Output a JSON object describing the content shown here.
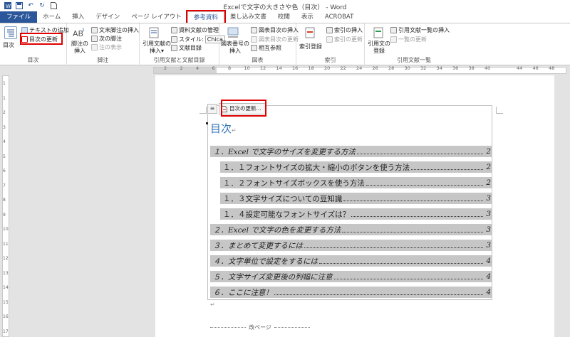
{
  "window": {
    "title": "Excelで文字の大きさや色（目次） - Word"
  },
  "qat": {
    "save_icon": "save-icon",
    "undo_icon": "undo-icon",
    "redo_icon": "redo-icon",
    "new_icon": "new-document-icon"
  },
  "tabs": [
    {
      "label": "ファイル"
    },
    {
      "label": "ホーム"
    },
    {
      "label": "挿入"
    },
    {
      "label": "デザイン"
    },
    {
      "label": "ページ レイアウト"
    },
    {
      "label": "参考資料"
    },
    {
      "label": "差し込み文書"
    },
    {
      "label": "校閲"
    },
    {
      "label": "表示"
    },
    {
      "label": "ACROBAT"
    }
  ],
  "ribbon": {
    "toc_group": {
      "label": "目次",
      "big_button": "目次",
      "add_text": "テキストの追加",
      "update_toc": "目次の更新"
    },
    "footnote_group": {
      "label": "脚注",
      "insert_footnote": "脚注の\n挿入",
      "insert_endnote": "文末脚注の挿入",
      "next_footnote": "次の脚注",
      "show_notes": "注の表示"
    },
    "citation_group": {
      "label": "引用文献と文献目録",
      "insert_citation": "引用文献の\n挿入",
      "manage_sources": "資料文献の管理",
      "style_label": "スタイル:",
      "style_value": "Chica",
      "bibliography": "文献目録"
    },
    "caption_group": {
      "label": "図表",
      "insert_caption": "図表番号の\n挿入",
      "insert_table_of_figures": "図表目次の挿入",
      "update_table": "図表目次の更新",
      "cross_reference": "相互参照"
    },
    "index_group": {
      "label": "索引",
      "mark_entry": "索引登録",
      "insert_index": "索引の挿入",
      "update_index": "索引の更新"
    },
    "authorities_group": {
      "label": "引用文献一覧",
      "mark_citation": "引用文の\n登録",
      "insert_table": "引用文献一覧の挿入",
      "update_table": "一覧の更新"
    }
  },
  "ruler": {
    "h_numbers": [
      "2",
      "2",
      "4",
      "6",
      "8",
      "10",
      "12",
      "14",
      "16",
      "18",
      "20",
      "22",
      "24",
      "26",
      "28",
      "30",
      "32",
      "34",
      "36",
      "38",
      "40",
      "",
      "44",
      "46",
      "48"
    ],
    "v_numbers": [
      "1",
      "1",
      "2",
      "3",
      "4",
      "5",
      "6",
      "7",
      "8",
      "9",
      "10",
      "11",
      "12",
      "13",
      "14",
      "15",
      "16",
      "17"
    ]
  },
  "document": {
    "update_button": "目次の更新...",
    "toc_heading": "目次",
    "entries": [
      {
        "level": 1,
        "text": "１．Excel で文字のサイズを変更する方法",
        "page": "2"
      },
      {
        "level": 2,
        "text": "１．１フォントサイズの拡大・縮小のボタンを使う方法",
        "page": "2"
      },
      {
        "level": 2,
        "text": "１．２フォントサイズボックスを使う方法",
        "page": "2"
      },
      {
        "level": 2,
        "text": "１．３文字サイズについての豆知識",
        "page": "3"
      },
      {
        "level": 2,
        "text": "１．４設定可能なフォントサイズは？",
        "page": "3"
      },
      {
        "level": 1,
        "text": "２．Excel で文字の色を変更する方法",
        "page": "3"
      },
      {
        "level": 1,
        "text": "３．まとめて変更するには",
        "page": "3"
      },
      {
        "level": 1,
        "text": "４．文字単位で設定をするには",
        "page": "4"
      },
      {
        "level": 1,
        "text": "５．文字サイズ変更後の列幅に注意",
        "page": "4"
      },
      {
        "level": 1,
        "text": "６．ここに注意！",
        "page": "4"
      }
    ],
    "page_break": "改ページ",
    "paragraph_mark": "↵"
  },
  "colors": {
    "accent": "#2b579a",
    "highlight_box": "#e00000",
    "toc_heading": "#2e74b5",
    "toc_field_shading": "#c6c6c6"
  }
}
